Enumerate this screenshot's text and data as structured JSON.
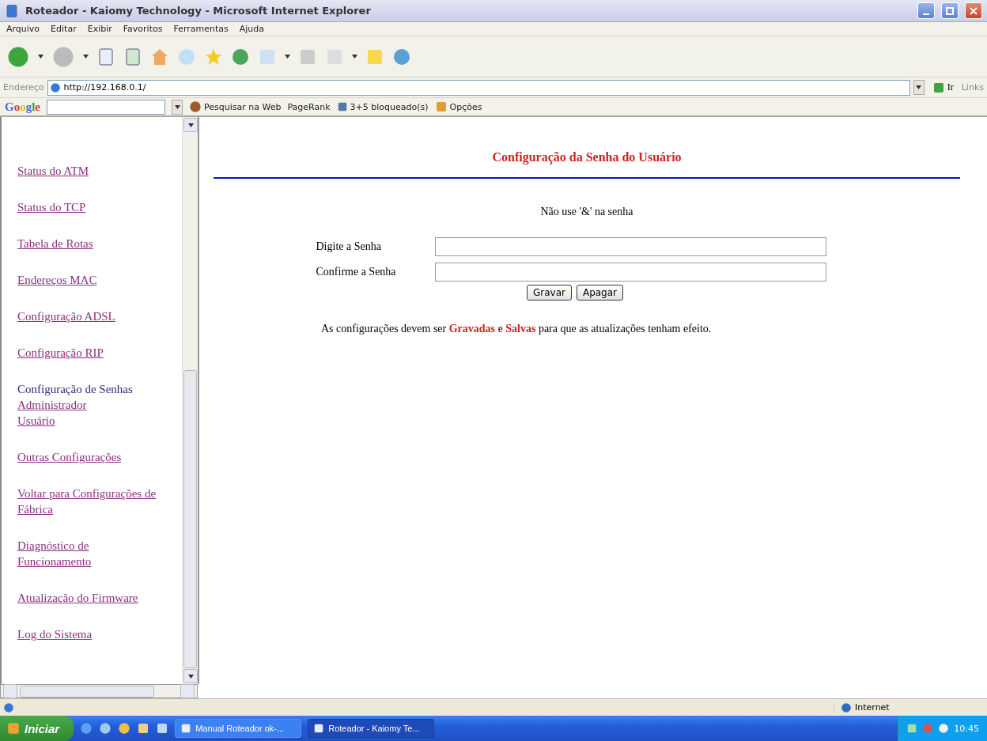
{
  "window": {
    "title": "Roteador - Kaiomy Technology - Microsoft Internet Explorer"
  },
  "menu": [
    "Arquivo",
    "Editar",
    "Exibir",
    "Favoritos",
    "Ferramentas",
    "Ajuda"
  ],
  "address": {
    "label": "Endereço",
    "url": "http://192.168.0.1/",
    "go": "Ir",
    "links": "Links"
  },
  "google_bar": {
    "brand": "Google",
    "search": "Pesquisar na Web",
    "pagerank": "PageRank",
    "blocked": "3+5 bloqueado(s)",
    "options": "Opções"
  },
  "sidebar": {
    "items": [
      {
        "kind": "link",
        "label": "Status do ATM"
      },
      {
        "kind": "link",
        "label": "Status do TCP"
      },
      {
        "kind": "link",
        "label": "Tabela de Rotas"
      },
      {
        "kind": "link",
        "label": "Endereços MAC"
      },
      {
        "kind": "link",
        "label": "Configuração ADSL"
      },
      {
        "kind": "link",
        "label": "Configuração RIP"
      },
      {
        "kind": "group",
        "label": "Configuração de Senhas",
        "children": [
          {
            "kind": "link",
            "label": "Administrador"
          },
          {
            "kind": "link",
            "label": "Usuário"
          }
        ]
      },
      {
        "kind": "link",
        "label": "Outras Configurações"
      },
      {
        "kind": "link",
        "label": "Voltar para Configurações de Fábrica"
      },
      {
        "kind": "link",
        "label": "Diagnóstico de Funcionamento"
      },
      {
        "kind": "link",
        "label": "Atualização do Firmware"
      },
      {
        "kind": "link",
        "label": "Log do Sistema"
      }
    ]
  },
  "main": {
    "heading": "Configuração da Senha do Usuário",
    "note": "Não use '&' na senha",
    "fields": [
      {
        "label": "Digite a Senha"
      },
      {
        "label": "Confirme a Senha"
      }
    ],
    "buttons": [
      "Gravar",
      "Apagar"
    ],
    "footer": "As configurações devem ser **Gravadas e Salvas** para que as atualizações tenham efeito."
  },
  "status_bar": {
    "zone": "Internet"
  },
  "taskbar": {
    "start": "Iniciar",
    "tasks": [
      {
        "label": "Manual Roteador ok-...",
        "selected": false
      },
      {
        "label": "Roteador - Kaiomy Te...",
        "selected": true
      }
    ],
    "clock": "10:45"
  }
}
